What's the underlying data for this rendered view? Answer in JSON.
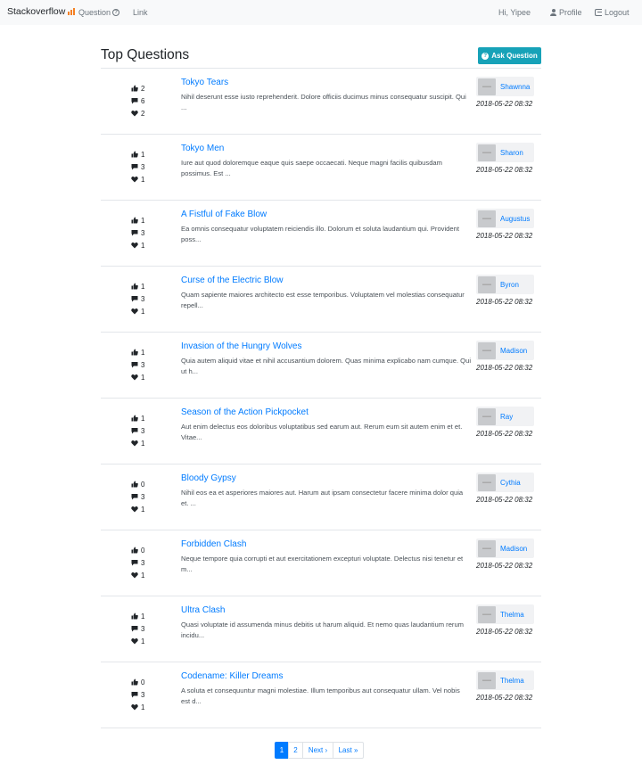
{
  "navbar": {
    "brand": "Stackoverflow",
    "question_link": "Question",
    "link": "Link",
    "greeting": "Hi, Yipee",
    "profile": "Profile",
    "logout": "Logout"
  },
  "header": {
    "title": "Top Questions",
    "ask_button": "Ask Question"
  },
  "questions": [
    {
      "title": "Tokyo Tears",
      "excerpt": "Nihil deserunt esse iusto reprehenderit. Dolore officiis ducimus minus consequatur suscipit. Qui ...",
      "likes": "2",
      "answers": "6",
      "favorites": "2",
      "author": "Shawnna",
      "date": "2018-05-22 08:32"
    },
    {
      "title": "Tokyo Men",
      "excerpt": "Iure aut quod doloremque eaque quis saepe occaecati. Neque magni facilis quibusdam possimus. Est ...",
      "likes": "1",
      "answers": "3",
      "favorites": "1",
      "author": "Sharon",
      "date": "2018-05-22 08:32"
    },
    {
      "title": "A Fistful of Fake Blow",
      "excerpt": "Ea omnis consequatur voluptatem reiciendis illo. Dolorum et soluta laudantium qui. Provident poss...",
      "likes": "1",
      "answers": "3",
      "favorites": "1",
      "author": "Augustus",
      "date": "2018-05-22 08:32"
    },
    {
      "title": "Curse of the Electric Blow",
      "excerpt": "Quam sapiente maiores architecto est esse temporibus. Voluptatem vel molestias consequatur repell...",
      "likes": "1",
      "answers": "3",
      "favorites": "1",
      "author": "Byron",
      "date": "2018-05-22 08:32"
    },
    {
      "title": "Invasion of the Hungry Wolves",
      "excerpt": "Quia autem aliquid vitae et nihil accusantium dolorem. Quas minima explicabo nam cumque. Qui ut h...",
      "likes": "1",
      "answers": "3",
      "favorites": "1",
      "author": "Madison",
      "date": "2018-05-22 08:32"
    },
    {
      "title": "Season of the Action Pickpocket",
      "excerpt": "Aut enim delectus eos doloribus voluptatibus sed earum aut. Rerum eum sit autem enim et et. Vitae...",
      "likes": "1",
      "answers": "3",
      "favorites": "1",
      "author": "Ray",
      "date": "2018-05-22 08:32"
    },
    {
      "title": "Bloody Gypsy",
      "excerpt": "Nihil eos ea et asperiores maiores aut. Harum aut ipsam consectetur facere minima dolor quia et. ...",
      "likes": "0",
      "answers": "3",
      "favorites": "1",
      "author": "Cythia",
      "date": "2018-05-22 08:32"
    },
    {
      "title": "Forbidden Clash",
      "excerpt": "Neque tempore quia corrupti et aut exercitationem excepturi voluptate. Delectus nisi tenetur et m...",
      "likes": "0",
      "answers": "3",
      "favorites": "1",
      "author": "Madison",
      "date": "2018-05-22 08:32"
    },
    {
      "title": "Ultra Clash",
      "excerpt": "Quasi voluptate id assumenda minus debitis ut harum aliquid. Et nemo quas laudantium rerum incidu...",
      "likes": "1",
      "answers": "3",
      "favorites": "1",
      "author": "Thelma",
      "date": "2018-05-22 08:32"
    },
    {
      "title": "Codename: Killer Dreams",
      "excerpt": "A soluta et consequuntur magni molestiae. Illum temporibus aut consequatur ullam. Vel nobis est d...",
      "likes": "0",
      "answers": "3",
      "favorites": "1",
      "author": "Thelma",
      "date": "2018-05-22 08:32"
    }
  ],
  "pagination": {
    "page1": "1",
    "page2": "2",
    "next": "Next ›",
    "last": "Last »"
  },
  "colors": {
    "link": "#007bff",
    "ask_button": "#17a2b8",
    "navbar_bg": "#f8f9fa",
    "brand_icon": "#f48024"
  }
}
